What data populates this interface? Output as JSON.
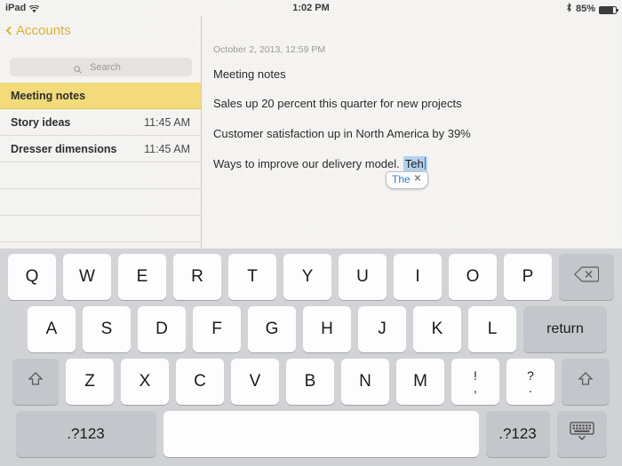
{
  "status_bar": {
    "device": "iPad",
    "wifi_icon": "wifi-icon",
    "time": "1:02 PM",
    "bluetooth_icon": "bluetooth-icon",
    "battery_percent": "85%",
    "battery_icon": "battery-icon",
    "battery_level": 85
  },
  "sidebar": {
    "back_label": "Accounts",
    "back_icon": "chevron-left-icon",
    "search": {
      "placeholder": "Search",
      "value": "",
      "icon": "search-icon"
    },
    "notes": [
      {
        "title": "Meeting notes",
        "time": "",
        "selected": true
      },
      {
        "title": "Story ideas",
        "time": "11:45 AM",
        "selected": false
      },
      {
        "title": "Dresser dimensions",
        "time": "11:45 AM",
        "selected": false
      }
    ],
    "empty_rows": 4
  },
  "toolbar": {
    "trash_icon": "trash-icon",
    "share_icon": "share-icon",
    "compose_icon": "compose-icon"
  },
  "note": {
    "date": "October 2, 2013, 12:59 PM",
    "lines": [
      "Meeting notes",
      "Sales up 20 percent this quarter for new projects",
      "Customer satisfaction up in North America by 39%"
    ],
    "last_line_prefix": "Ways to improve our delivery model.",
    "typed_word": "Teh",
    "autocorrect": {
      "suggestion": "The",
      "dismiss_icon": "close-icon",
      "dismiss_label": "✕"
    }
  },
  "keyboard": {
    "row1": [
      "Q",
      "W",
      "E",
      "R",
      "T",
      "Y",
      "U",
      "I",
      "O",
      "P"
    ],
    "backspace_icon": "backspace-icon",
    "row2": [
      "A",
      "S",
      "D",
      "F",
      "G",
      "H",
      "J",
      "K",
      "L"
    ],
    "return_label": "return",
    "row3": [
      "Z",
      "X",
      "C",
      "V",
      "B",
      "N",
      "M"
    ],
    "punct": [
      {
        "top": "!",
        "bot": ","
      },
      {
        "top": "?",
        "bot": "."
      }
    ],
    "shift_icon": "shift-icon",
    "numeric_label": ".?123",
    "numeric_label_right": ".?123",
    "space_label": "",
    "dismiss_icon": "keyboard-dismiss-icon"
  },
  "colors": {
    "accent": "#ddb134",
    "selection_row": "#f2db78",
    "text_selection": "#b4d0ee",
    "suggestion_text": "#3a7ddc",
    "keyboard_bg": "#d2d4d7",
    "key_light": "#fdfdfd",
    "key_dark": "#c3c6ca"
  }
}
